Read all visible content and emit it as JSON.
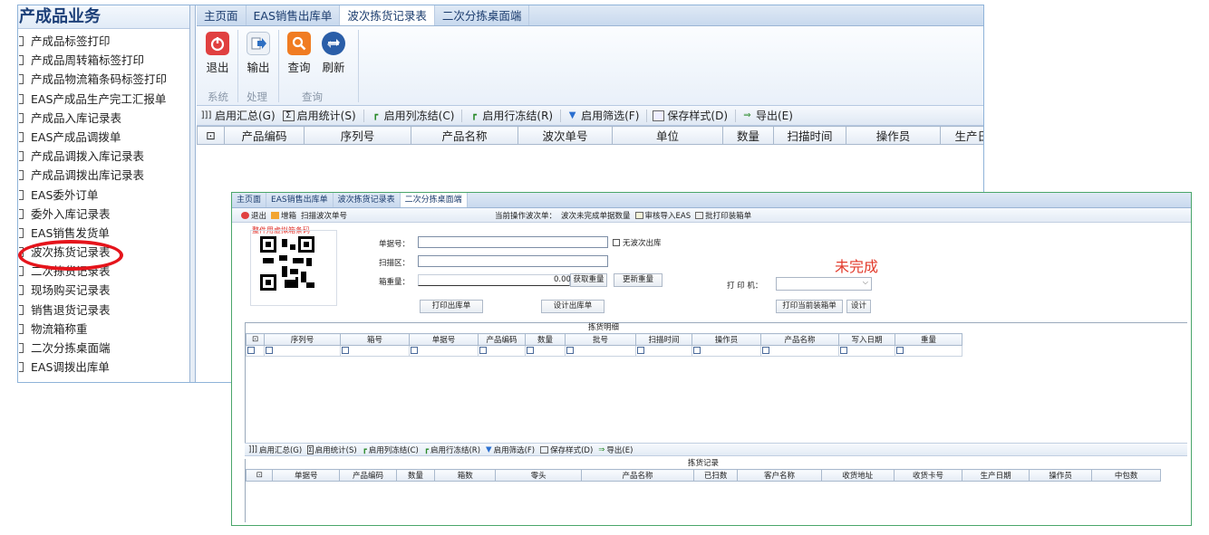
{
  "window_a": {
    "sidebar": {
      "title": "产成品业务",
      "items": [
        {
          "label": "产成品标签打印"
        },
        {
          "label": "产成品周转箱标签打印"
        },
        {
          "label": "产成品物流箱条码标签打印"
        },
        {
          "label": "EAS产成品生产完工汇报单"
        },
        {
          "label": "产成品入库记录表"
        },
        {
          "label": "EAS产成品调拨单"
        },
        {
          "label": "产成品调拨入库记录表"
        },
        {
          "label": "产成品调拨出库记录表"
        },
        {
          "label": "EAS委外订单"
        },
        {
          "label": "委外入库记录表"
        },
        {
          "label": "EAS销售发货单"
        },
        {
          "label": "波次拣货记录表"
        },
        {
          "label": "二次拣货记录表"
        },
        {
          "label": "现场购买记录表"
        },
        {
          "label": "销售退货记录表"
        },
        {
          "label": "物流箱称重"
        },
        {
          "label": "二次分拣桌面端"
        },
        {
          "label": "EAS调拨出库单"
        }
      ]
    },
    "tabs": [
      {
        "label": "主页面"
      },
      {
        "label": "EAS销售出库单"
      },
      {
        "label": "波次拣货记录表"
      },
      {
        "label": "二次分拣桌面端"
      }
    ],
    "ribbon": {
      "exit": "退出",
      "output": "输出",
      "query": "查询",
      "refresh": "刷新",
      "group_system": "系统",
      "group_process": "处理",
      "group_query": "查询"
    },
    "toolbar": {
      "summary": "启用汇总(G)",
      "stats": "启用统计(S)",
      "col_freeze": "启用列冻结(C)",
      "row_freeze": "启用行冻结(R)",
      "filter": "启用筛选(F)",
      "save_style": "保存样式(D)",
      "export": "导出(E)"
    },
    "grid_headers": [
      "产品编码",
      "序列号",
      "产品名称",
      "波次单号",
      "单位",
      "数量",
      "扫描时间",
      "操作员",
      "生产日期"
    ]
  },
  "window_b": {
    "tabs": [
      {
        "label": "主页面"
      },
      {
        "label": "EAS销售出库单"
      },
      {
        "label": "波次拣货记录表"
      },
      {
        "label": "二次分拣桌面端"
      }
    ],
    "toolbar": {
      "exit": "退出",
      "add_box": "增箱",
      "scan_wave": "扫描波次单号",
      "current_wave": "当前操作波次单：",
      "wave_unfinished": "波次未完成单据数量",
      "audit_import": "审核导入EAS",
      "batch_print": "批打印装箱单"
    },
    "form": {
      "qr_label": "整件用虚拟箱条码",
      "order_no_label": "单据号：",
      "no_wave_out": "无波次出库",
      "scan_area_label": "扫描区：",
      "box_weight_label": "箱重量：",
      "weight_value": "0.00",
      "get_weight": "获取重量",
      "update_weight": "更新重量",
      "printer_label": "打 印 机：",
      "print_outbound": "打印出库单",
      "design_outbound": "设计出库单",
      "print_current_box": "打印当前装箱单",
      "design": "设计",
      "status": "未完成"
    },
    "detail": {
      "caption": "拣货明细",
      "headers": [
        "序列号",
        "箱号",
        "单据号",
        "产品编码",
        "数量",
        "批号",
        "扫描时间",
        "操作员",
        "产品名称",
        "写入日期",
        "重量"
      ]
    },
    "toolbar2": {
      "summary": "启用汇总(G)",
      "stats": "启用统计(S)",
      "col_freeze": "启用列冻结(C)",
      "row_freeze": "启用行冻结(R)",
      "filter": "启用筛选(F)",
      "save_style": "保存样式(D)",
      "export": "导出(E)"
    },
    "records": {
      "caption": "拣货记录",
      "headers": [
        "单据号",
        "产品编码",
        "数量",
        "箱数",
        "零头",
        "产品名称",
        "已扫数",
        "客户名称",
        "收货地址",
        "收货卡号",
        "生产日期",
        "操作员",
        "中包数"
      ]
    }
  },
  "colors": {
    "accent_blue": "#1c3f78",
    "status_red": "#e23a2b",
    "annotation_red": "#e5141b",
    "window_b_border": "#4aa66a"
  }
}
